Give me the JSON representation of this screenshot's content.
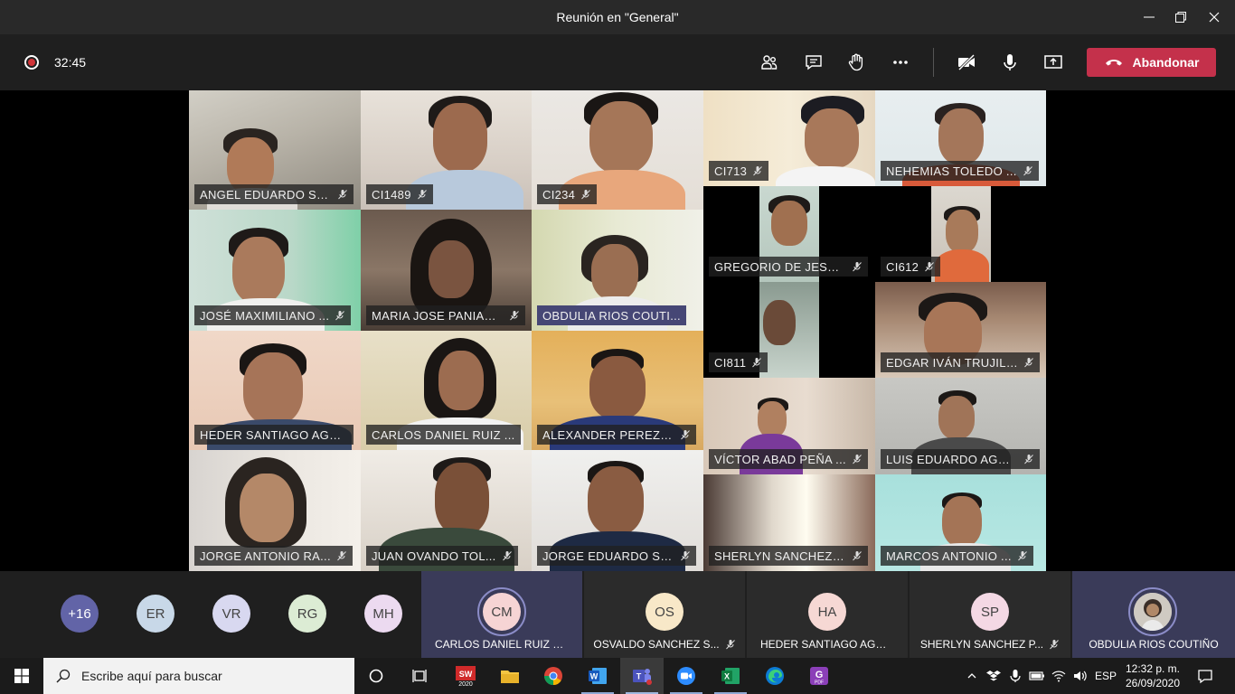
{
  "window": {
    "title": "Reunión en \"General\""
  },
  "meeting": {
    "elapsed": "32:45",
    "leave_label": "Abandonar"
  },
  "tiles": [
    {
      "name": "ANGEL EDUARDO SO..."
    },
    {
      "name": "CI1489"
    },
    {
      "name": "CI234"
    },
    {
      "name": "CI713"
    },
    {
      "name": "NEHEMIAS TOLEDO ..."
    },
    {
      "name": "JOSÉ MAXIMILIANO ..."
    },
    {
      "name": "MARIA JOSE PANIAG..."
    },
    {
      "name": "OBDULIA RIOS  COUTI..."
    },
    {
      "name": "GREGORIO DE JESUS..."
    },
    {
      "name": "CI612"
    },
    {
      "name": "CI811"
    },
    {
      "name": "EDGAR IVÁN TRUJILL..."
    },
    {
      "name": "HEDER SANTIAGO AGU..."
    },
    {
      "name": "CARLOS DANIEL RUIZ ..."
    },
    {
      "name": "ALEXANDER PEREZ D..."
    },
    {
      "name": "VÍCTOR ABAD PEÑA ..."
    },
    {
      "name": "LUIS EDUARDO AGUI..."
    },
    {
      "name": "JORGE ANTONIO RA..."
    },
    {
      "name": "JUAN OVANDO TOL..."
    },
    {
      "name": "JORGE EDUARDO SO..."
    },
    {
      "name": "SHERLYN SANCHEZ ..."
    },
    {
      "name": "MARCOS ANTONIO ..."
    }
  ],
  "roster": {
    "overflow": "+16",
    "initials": [
      "ER",
      "VR",
      "RG",
      "MH"
    ],
    "cards": [
      {
        "initials": "CM",
        "name": "CARLOS DANIEL RUIZ ME...",
        "muted": false,
        "speaking": true
      },
      {
        "initials": "OS",
        "name": "OSVALDO SANCHEZ S...",
        "muted": true,
        "speaking": false
      },
      {
        "initials": "HA",
        "name": "HEDER SANTIAGO AGUILAR",
        "muted": false,
        "speaking": false
      },
      {
        "initials": "SP",
        "name": "SHERLYN SANCHEZ P...",
        "muted": true,
        "speaking": false
      },
      {
        "initials": "",
        "name": "OBDULIA RIOS COUTIÑO",
        "muted": false,
        "speaking": true
      }
    ]
  },
  "taskbar": {
    "search_placeholder": "Escribe aquí para buscar",
    "sw_badge": "2020",
    "pdf_badge": "PDF",
    "language": "ESP",
    "time": "12:32 p. m.",
    "date": "26/09/2020"
  },
  "colors": {
    "leave": "#c4314b",
    "record": "#d13438",
    "presenter_tag": "#464775",
    "speaking_ring": "#8b8cc7",
    "overflow_avatar": "#6264a7"
  }
}
